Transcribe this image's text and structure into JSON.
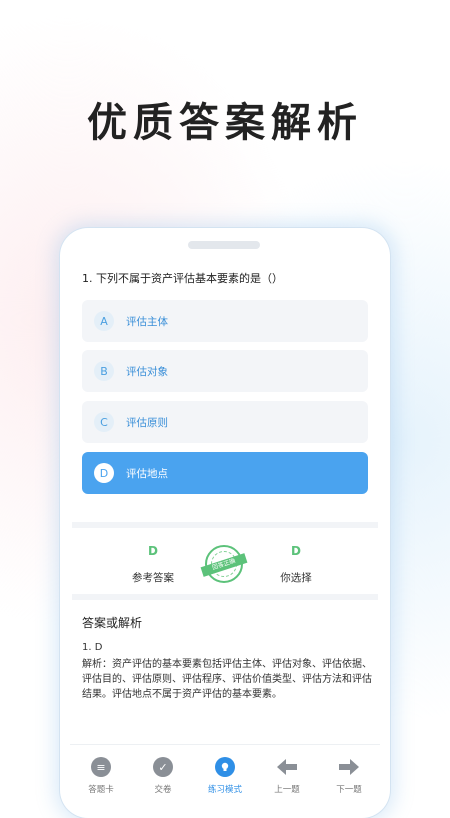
{
  "headline": "优质答案解析",
  "question": "1. 下列不属于资产评估基本要素的是（）",
  "options": [
    {
      "letter": "A",
      "text": "评估主体"
    },
    {
      "letter": "B",
      "text": "评估对象"
    },
    {
      "letter": "C",
      "text": "评估原则"
    },
    {
      "letter": "D",
      "text": "评估地点"
    }
  ],
  "selected_option": "D",
  "answer": {
    "reference_letter": "D",
    "reference_label": "参考答案",
    "stamp_text": "回答正确",
    "your_letter": "D",
    "your_label": "你选择"
  },
  "analysis": {
    "title": "答案或解析",
    "answer_line": "1. D",
    "text": "解析：资产评估的基本要素包括评估主体、评估对象、评估依据、评估目的、评估原则、评估程序、评估价值类型、评估方法和评估结果。评估地点不属于资产评估的基本要素。"
  },
  "tabbar": [
    {
      "label": "答题卡",
      "icon": "list-icon"
    },
    {
      "label": "交卷",
      "icon": "check-icon"
    },
    {
      "label": "练习模式",
      "icon": "bulb-icon",
      "active": true
    },
    {
      "label": "上一题",
      "icon": "arrow-left-icon"
    },
    {
      "label": "下一题",
      "icon": "arrow-right-icon"
    }
  ],
  "colors": {
    "accent": "#4aa3ef",
    "correct": "#5cc27a",
    "tab_active": "#2f8fe6"
  }
}
